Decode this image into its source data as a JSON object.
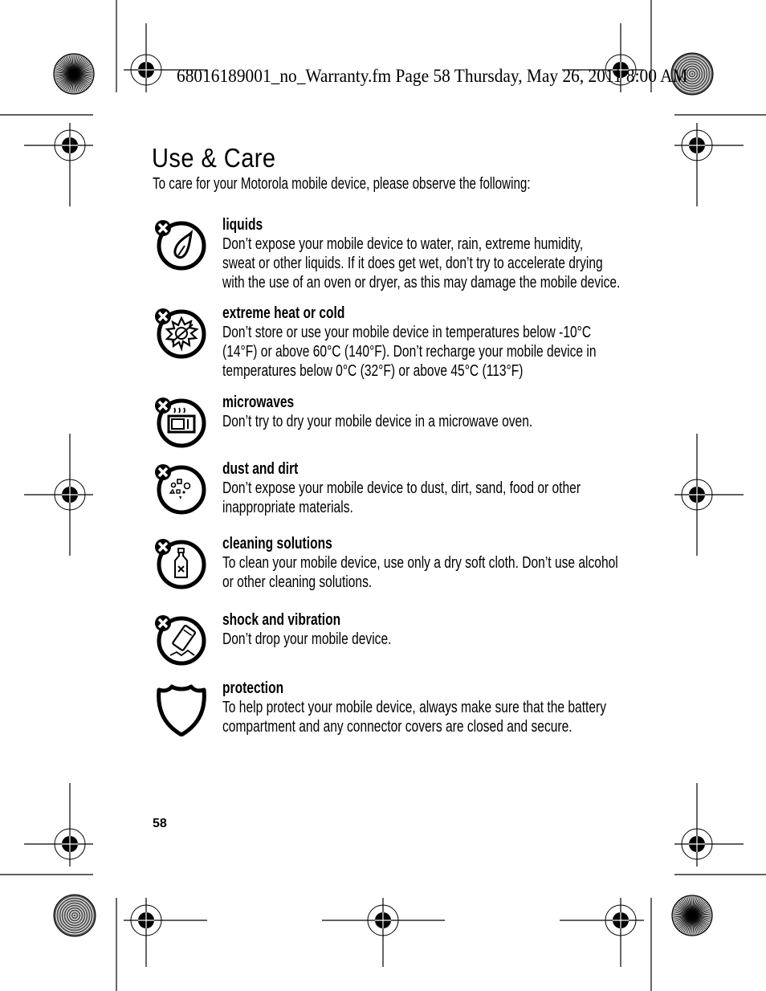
{
  "slug": "68016189001_no_Warranty.fm  Page 58  Thursday, May 26, 2011  8:00 AM",
  "page": {
    "title": "Use & Care",
    "intro": "To care for your Motorola mobile device, please observe the following:",
    "page_number": "58"
  },
  "items": [
    {
      "icon": "liquid-drop-prohibited-icon",
      "heading": "liquids",
      "lines": [
        "Don’t expose your mobile device to water, rain, extreme humidity,",
        "sweat or other liquids. If it does get wet, don’t try to accelerate drying",
        "with the use of an oven or dryer, as this may damage the mobile device."
      ]
    },
    {
      "icon": "heat-cold-prohibited-icon",
      "heading": "extreme heat or cold",
      "lines": [
        "Don’t store or use your mobile device in temperatures below -10°C",
        "(14°F) or above 60°C (140°F). Don’t recharge your mobile device in",
        "temperatures below 0°C (32°F) or above 45°C (113°F)"
      ]
    },
    {
      "icon": "microwave-prohibited-icon",
      "heading": "microwaves",
      "lines": [
        "Don’t try to dry your mobile device in a microwave oven."
      ]
    },
    {
      "icon": "dust-dirt-prohibited-icon",
      "heading": "dust and dirt",
      "lines": [
        "Don’t expose your mobile device to dust, dirt, sand, food or other",
        "inappropriate materials."
      ]
    },
    {
      "icon": "cleaning-bottle-prohibited-icon",
      "heading": "cleaning solutions",
      "lines": [
        "To clean your mobile device, use only a dry soft cloth. Don’t use alcohol",
        "or other cleaning solutions."
      ]
    },
    {
      "icon": "dropped-phone-prohibited-icon",
      "heading": "shock and vibration",
      "lines": [
        "Don’t drop your mobile device."
      ]
    },
    {
      "icon": "shield-icon",
      "heading": "protection",
      "lines": [
        "To help protect your mobile device, always make sure that the battery",
        "compartment and any connector covers are closed and secure."
      ]
    }
  ]
}
